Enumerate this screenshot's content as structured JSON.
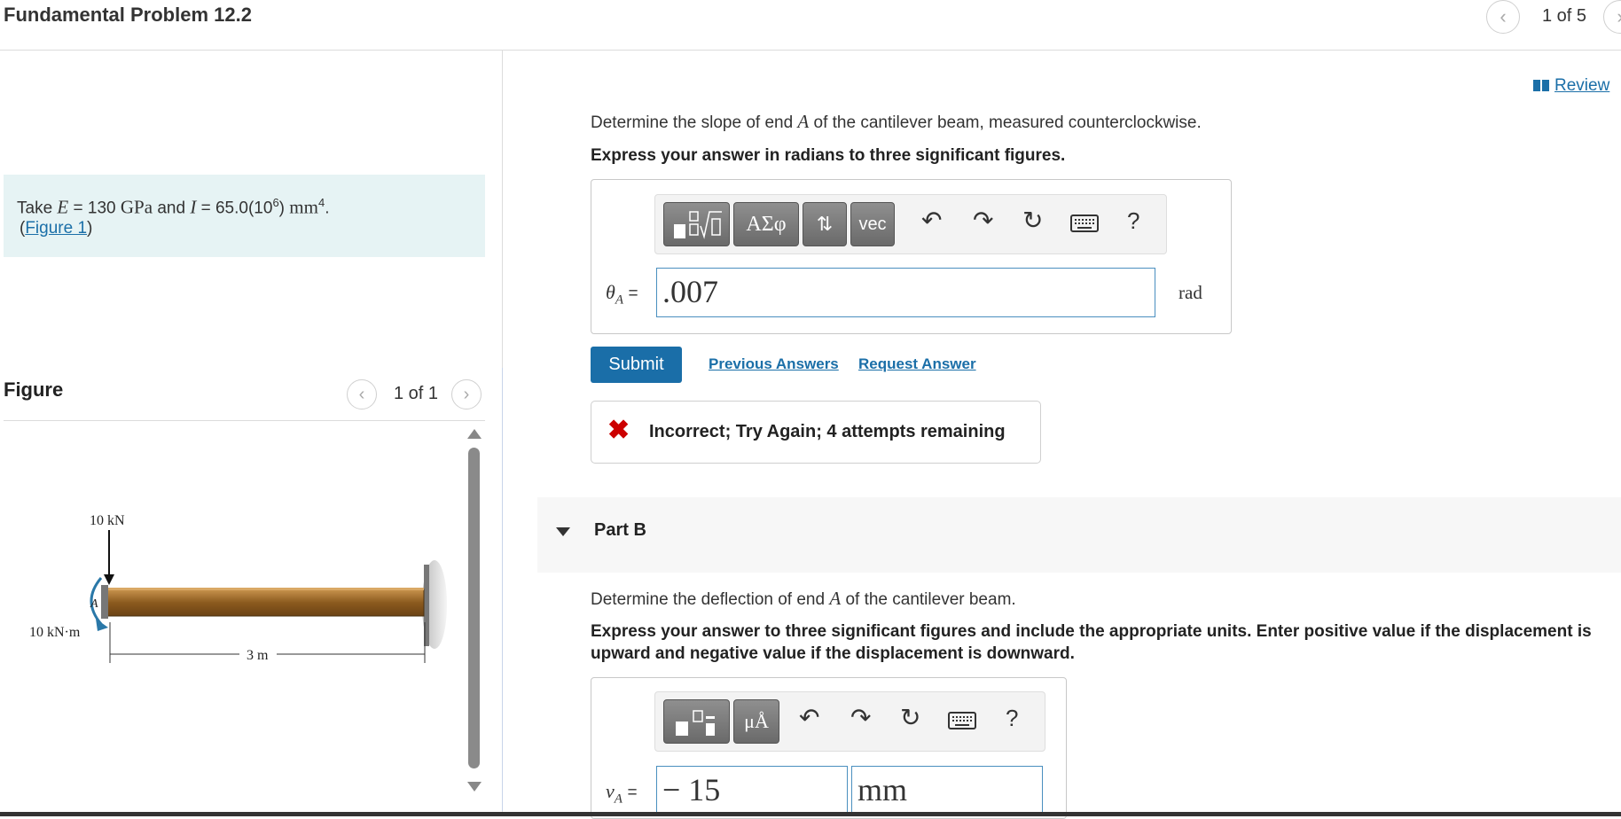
{
  "header": {
    "title": "Fundamental Problem 12.2",
    "pager": "1 of 5"
  },
  "left": {
    "given": {
      "take": "Take",
      "E_sym": "E",
      "E_val": "= 130",
      "E_unit": "GPa",
      "and": "and",
      "I_sym": "I",
      "I_val": "= 65.0(10",
      "I_exp": "6",
      "I_close": ")",
      "I_unit": "mm",
      "I_unit_exp": "4",
      "period": "."
    },
    "figure_link_open": "(",
    "figure_link": "Figure 1",
    "figure_link_close": ")",
    "figure_heading": "Figure",
    "figure_pager": "1 of 1",
    "figure_labels": {
      "force": "10 kN",
      "moment": "10 kN·m",
      "point": "A",
      "length": "3 m"
    }
  },
  "right": {
    "review": "Review",
    "partA": {
      "question_pre": "Determine the slope of end",
      "question_var": "A",
      "question_post": "of the cantilever beam, measured counterclockwise.",
      "instruction": "Express your answer in radians to three significant figures.",
      "toolbar": {
        "sym": "ΑΣφ",
        "vec": "vec",
        "help": "?"
      },
      "var": "θ",
      "var_sub": "A",
      "equals": "=",
      "value": ".007",
      "unit": "rad",
      "submit": "Submit",
      "previous_answers": "Previous Answers",
      "request_answer": "Request Answer",
      "feedback": "Incorrect; Try Again; 4 attempts remaining"
    },
    "partB": {
      "title": "Part B",
      "question_pre": "Determine the deflection of end",
      "question_var": "A",
      "question_post": "of the cantilever beam.",
      "instruction": "Express your answer to three significant figures and include the appropriate units. Enter positive value if the displacement is upward and negative value if the displacement is downward.",
      "toolbar": {
        "units": "μÅ",
        "help": "?"
      },
      "var": "v",
      "var_sub": "A",
      "equals": "=",
      "value": "− 15",
      "unit_value": "mm"
    }
  },
  "colors": {
    "accent": "#1a6ea8",
    "error": "#cc0000",
    "given_bg": "#e6f3f4",
    "beam": "#8b5a1e"
  }
}
